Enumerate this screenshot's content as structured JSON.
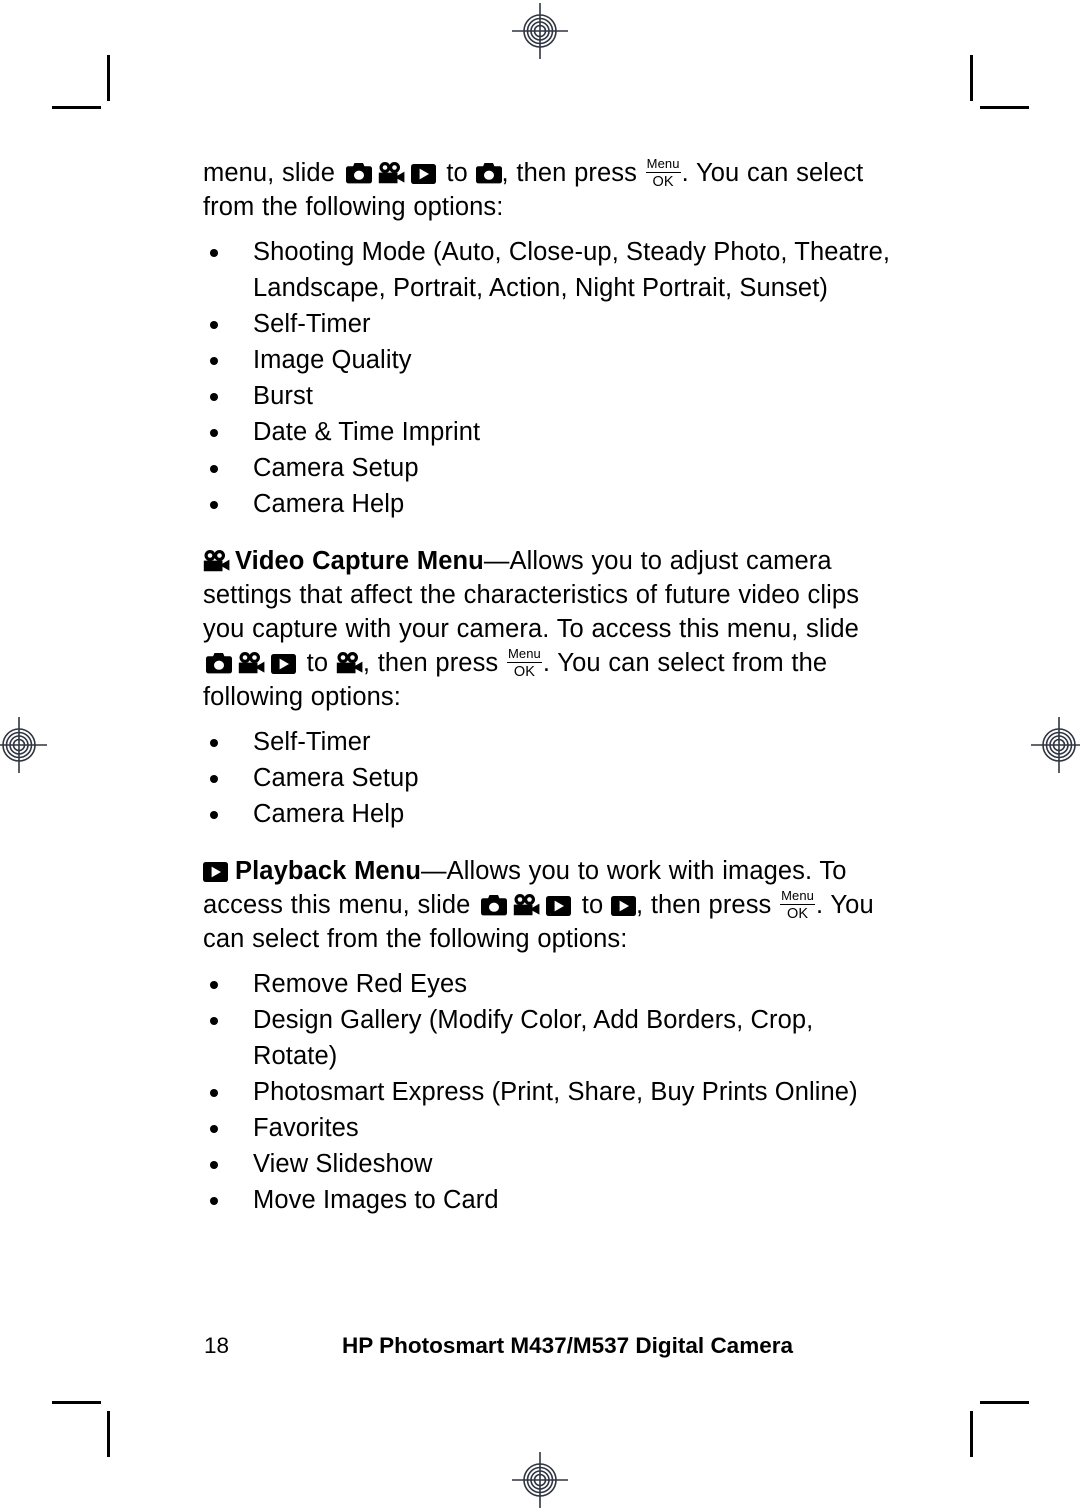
{
  "page": {
    "number": "18",
    "footer_title": "HP Photosmart M437/M537 Digital Camera"
  },
  "icons": {
    "still_camera": "still-camera-icon",
    "video_camera": "video-camera-icon",
    "playback": "playback-icon",
    "menu_ok_top": "Menu",
    "menu_ok_bottom": "OK",
    "registration_target": "registration-target-icon",
    "crop_mark": "crop-mark-icon"
  },
  "capture_menu": {
    "line1_a": "menu, slide ",
    "line1_b": " to ",
    "line1_c": ", then press ",
    "line1_d": ". You can select from the following options:",
    "options": [
      "Shooting Mode (Auto, Close-up, Steady Photo, Theatre, Landscape, Portrait, Action, Night Portrait, Sunset)",
      "Self-Timer",
      "Image Quality",
      "Burst",
      "Date & Time Imprint",
      "Camera Setup",
      "Camera Help"
    ]
  },
  "video_capture_menu": {
    "title": "Video Capture Menu",
    "desc": "—Allows you to adjust camera settings that affect the characteristics of future video clips you capture with your camera. To access this menu, slide ",
    "mid_a": " to ",
    "mid_b": ", then press ",
    "tail": ". You can select from the following options:",
    "options": [
      "Self-Timer",
      "Camera Setup",
      "Camera Help"
    ]
  },
  "playback_menu": {
    "title": "Playback Menu",
    "desc": "—Allows you to work with images. To access this menu, slide ",
    "mid_a": " to ",
    "mid_b": ", then press ",
    "tail": ". You can select from the following options:",
    "options": [
      "Remove Red Eyes",
      "Design Gallery (Modify Color, Add Borders, Crop, Rotate)",
      "Photosmart Express (Print, Share, Buy Prints Online)",
      "Favorites",
      "View Slideshow",
      "Move Images to Card"
    ]
  }
}
